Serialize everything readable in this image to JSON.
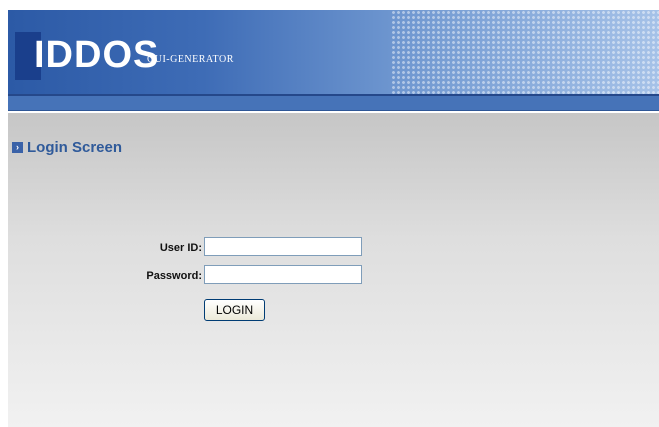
{
  "header": {
    "logo_text": "IDDOS",
    "logo_subtitle": "GUI-GENERATOR"
  },
  "page": {
    "title": "Login Screen",
    "bullet_icon": "chevron-right-icon"
  },
  "form": {
    "user_id_label": "User ID:",
    "user_id_value": "",
    "password_label": "Password:",
    "password_value": "",
    "login_button_label": "LOGIN"
  },
  "colors": {
    "header_blue": "#3e6cb6",
    "nav_bar": "#4673b8",
    "title_text": "#2f5a9a"
  }
}
